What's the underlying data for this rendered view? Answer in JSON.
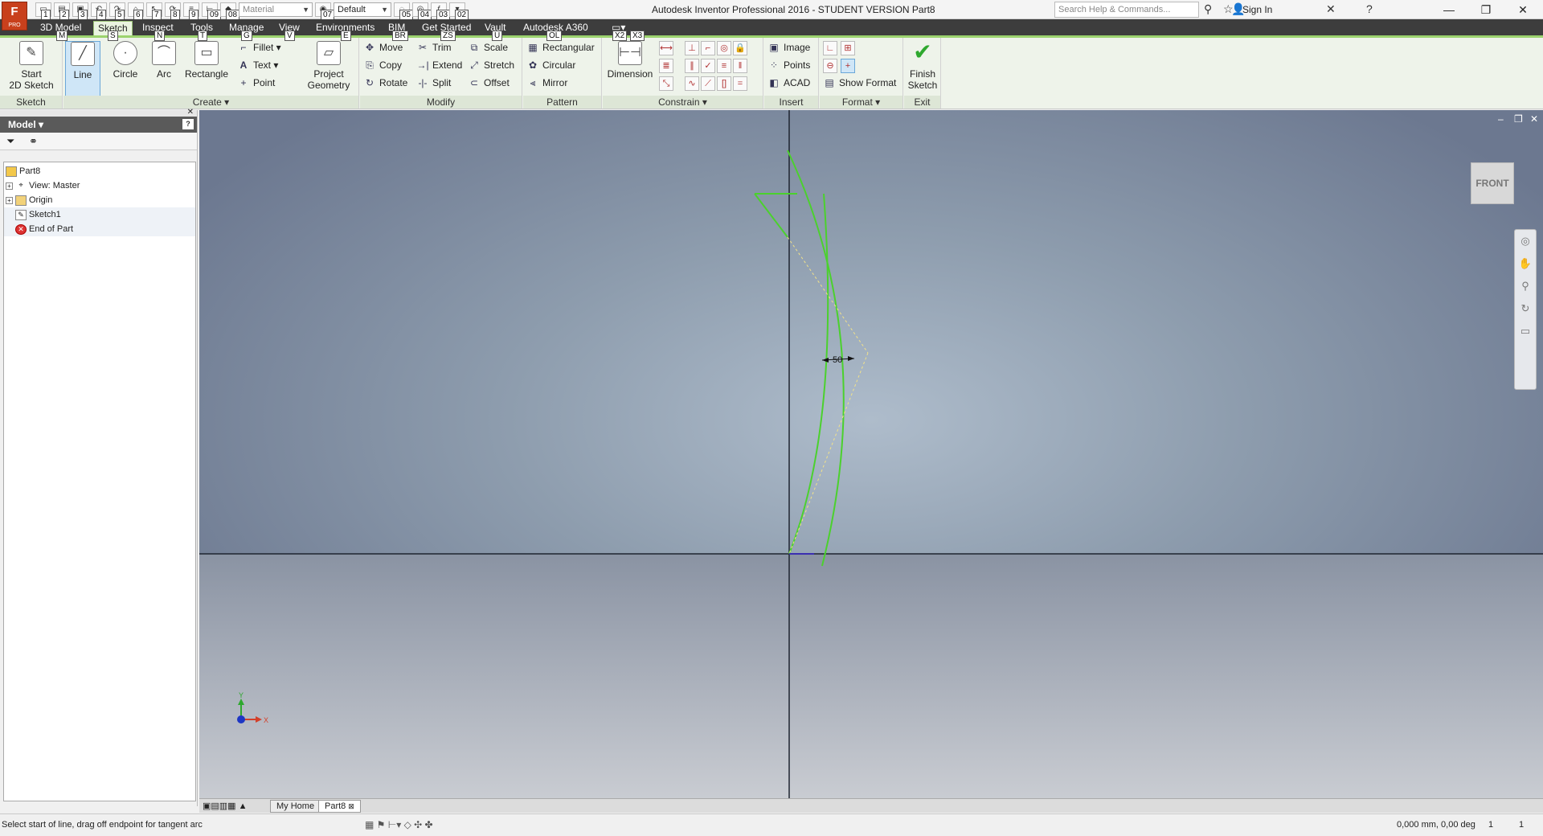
{
  "app": {
    "logo_letter": "F",
    "logo_sub": "PRO",
    "title": "Autodesk Inventor Professional 2016 - STUDENT VERSION    Part8"
  },
  "quick_access": {
    "keytips": [
      "1",
      "2",
      "3",
      "4",
      "5",
      "6",
      "7",
      "8",
      "9",
      "09",
      "08",
      "07",
      "06",
      "05",
      "04",
      "03",
      "02"
    ],
    "material_combo": "Material",
    "appearance_combo": "Default"
  },
  "search": {
    "placeholder": "Search Help & Commands..."
  },
  "signin": {
    "label": "Sign In"
  },
  "menu_tabs": [
    "3D Model",
    "Sketch",
    "Inspect",
    "Tools",
    "Manage",
    "View",
    "Environments",
    "BIM",
    "Get Started",
    "Vault",
    "Autodesk A360"
  ],
  "tab_keytips": {
    "model": "M",
    "sketch": "S",
    "arc": "N",
    "rect": "T",
    "fillet": "G",
    "text": "V",
    "project": "E",
    "move": "BR",
    "trim": "ZS",
    "scale": "U",
    "rect_pattern": "OL",
    "dim1": "X2",
    "dim2": "X3"
  },
  "ribbon": {
    "sketch_panel": {
      "title": "Sketch",
      "start": "Start\n2D Sketch"
    },
    "create_panel": {
      "title": "Create",
      "line": "Line",
      "circle": "Circle",
      "arc": "Arc",
      "rectangle": "Rectangle",
      "fillet": "Fillet",
      "text": "Text",
      "point": "Point",
      "project": "Project\nGeometry"
    },
    "modify_panel": {
      "title": "Modify",
      "move": "Move",
      "trim": "Trim",
      "scale": "Scale",
      "copy": "Copy",
      "extend": "Extend",
      "stretch": "Stretch",
      "rotate": "Rotate",
      "split": "Split",
      "offset": "Offset"
    },
    "pattern_panel": {
      "title": "Pattern",
      "rectangular": "Rectangular",
      "circular": "Circular",
      "mirror": "Mirror"
    },
    "constrain_panel": {
      "title": "Constrain",
      "dimension": "Dimension"
    },
    "insert_panel": {
      "title": "Insert",
      "image": "Image",
      "points": "Points",
      "acad": "ACAD"
    },
    "format_panel": {
      "title": "Format",
      "show_format": "Show Format"
    },
    "exit_panel": {
      "title": "Exit",
      "finish": "Finish\nSketch"
    }
  },
  "browser": {
    "header": "Model",
    "tree": [
      {
        "label": "Part8"
      },
      {
        "label": "View: Master"
      },
      {
        "label": "Origin"
      },
      {
        "label": "Sketch1"
      },
      {
        "label": "End of Part"
      }
    ]
  },
  "graphics": {
    "viewcube": "FRONT",
    "dimension_value": "50",
    "axis_x": "X",
    "axis_y": "Y"
  },
  "doc_tabs": [
    "My Home",
    "Part8"
  ],
  "status": {
    "message": "Select start of line, drag off endpoint for tangent arc",
    "coords": "0,000 mm, 0,00 deg",
    "count1": "1",
    "count2": "1"
  },
  "colors": {
    "sketch_green": "#4bd12d",
    "tab_bar": "#3d3d3d",
    "ribbon_accent": "#9cd36e"
  }
}
